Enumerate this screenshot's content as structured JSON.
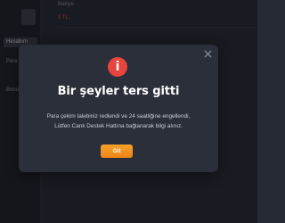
{
  "background": {
    "top_label": "Bakiye",
    "top_value": "0 TL",
    "sidebar_item_1": "Hesabım",
    "sidebar_item_2": "Para Çek",
    "sidebar_item_3": "Bonus"
  },
  "modal": {
    "icon": "alert-circle-icon",
    "icon_glyph": "i",
    "icon_color": "#e6443e",
    "close_icon": "close-icon",
    "title": "Bir şeyler ters gitti",
    "message_line1": "Para çekim talebiniz redlendi ve 24 saatliğine engellendi,",
    "message_line2": "Lütfen Canlı Destek Hattına bağlanarak bilgi alınız.",
    "button_label": "Git",
    "button_color": "#f08a1b"
  }
}
